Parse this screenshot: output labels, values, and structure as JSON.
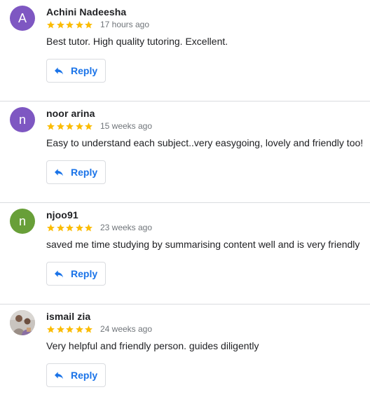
{
  "colors": {
    "star": "#fbbc04",
    "reply_accent": "#1a73e8",
    "divider": "#dadce0",
    "secondary_text": "#70757a"
  },
  "reviews": [
    {
      "avatar_letter": "A",
      "avatar_color": "#7e57c2",
      "name": "Achini Nadeesha",
      "rating": 5,
      "time": "17 hours ago",
      "comment": "Best tutor. High quality tutoring. Excellent.",
      "reply_label": "Reply"
    },
    {
      "avatar_letter": "n",
      "avatar_color": "#7e57c2",
      "name": "noor arina",
      "rating": 5,
      "time": "15 weeks ago",
      "comment": "Easy to understand each subject..very easygoing, lovely and friendly too!",
      "reply_label": "Reply"
    },
    {
      "avatar_letter": "n",
      "avatar_color": "#689f38",
      "name": "njoo91",
      "rating": 5,
      "time": "23 weeks ago",
      "comment": "saved me time studying by summarising content well and is very friendly",
      "reply_label": "Reply"
    },
    {
      "avatar_icon": "profile-photo",
      "name": "ismail zia",
      "rating": 5,
      "time": "24 weeks ago",
      "comment": "Very helpful and friendly person. guides diligently",
      "reply_label": "Reply"
    }
  ]
}
